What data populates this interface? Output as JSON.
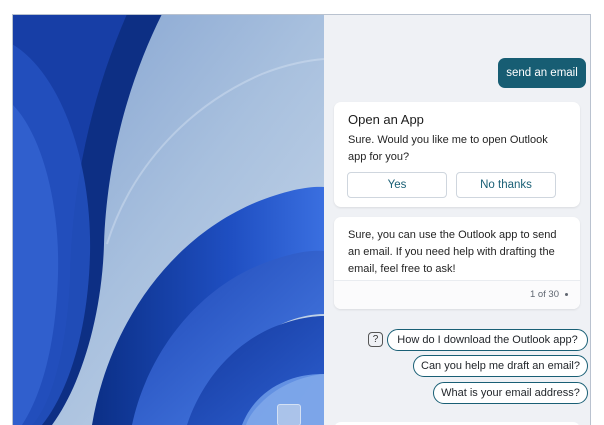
{
  "chat": {
    "user_message": "send an email",
    "open_app_card": {
      "title": "Open an App",
      "text": "Sure. Would you like me to open Outlook app for you?",
      "yes_label": "Yes",
      "no_label": "No thanks"
    },
    "answer_card": {
      "text": "Sure, you can use the Outlook app to send an email. If you need help with drafting the email, feel free to ask!",
      "page_count": "1 of 30"
    },
    "help_icon_glyph": "?",
    "suggestions": [
      "How do I download the Outlook app?",
      "Can you help me draft an email?",
      "What is your email address?"
    ]
  },
  "icons": {
    "help": "question-mark-icon",
    "recycle_bin": "recycle-bin-icon",
    "page_dot": "dot-icon"
  },
  "colors": {
    "accent": "#175d73",
    "chat_background": "#eff1f5",
    "wallpaper_blue": "#1d4bbd"
  }
}
